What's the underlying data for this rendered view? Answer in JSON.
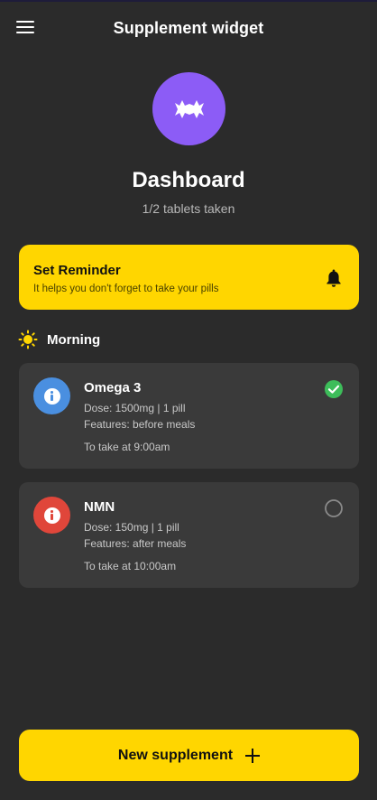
{
  "app_bar": {
    "title": "Supplement widget",
    "menu_icon": "hamburger-menu-icon"
  },
  "header": {
    "avatar_icon": "eye-mask-icon",
    "avatar_color": "#8c5cf6",
    "title": "Dashboard",
    "subtitle": "1/2 tablets taken"
  },
  "reminder": {
    "title": "Set Reminder",
    "description": "It helps you don't forget to take your pills",
    "icon": "bell-icon",
    "color": "#ffd600"
  },
  "section": {
    "icon": "sun-icon",
    "title": "Morning"
  },
  "supplements": [
    {
      "name": "Omega 3",
      "dose": "Dose: 1500mg | 1 pill",
      "features": "Features: before meals",
      "time": "To take at 9:00am",
      "icon_color": "#4a8fe0",
      "taken": true
    },
    {
      "name": "NMN",
      "dose": "Dose: 150mg | 1 pill",
      "features": "Features: after meals",
      "time": "To take at 10:00am",
      "icon_color": "#e0463a",
      "taken": false
    }
  ],
  "colors": {
    "background": "#2b2b2b",
    "card": "#3a3a3a",
    "accent": "#ffd600",
    "check_green": "#3dbd5a"
  },
  "new_button": {
    "label": "New supplement",
    "icon": "plus-icon"
  }
}
